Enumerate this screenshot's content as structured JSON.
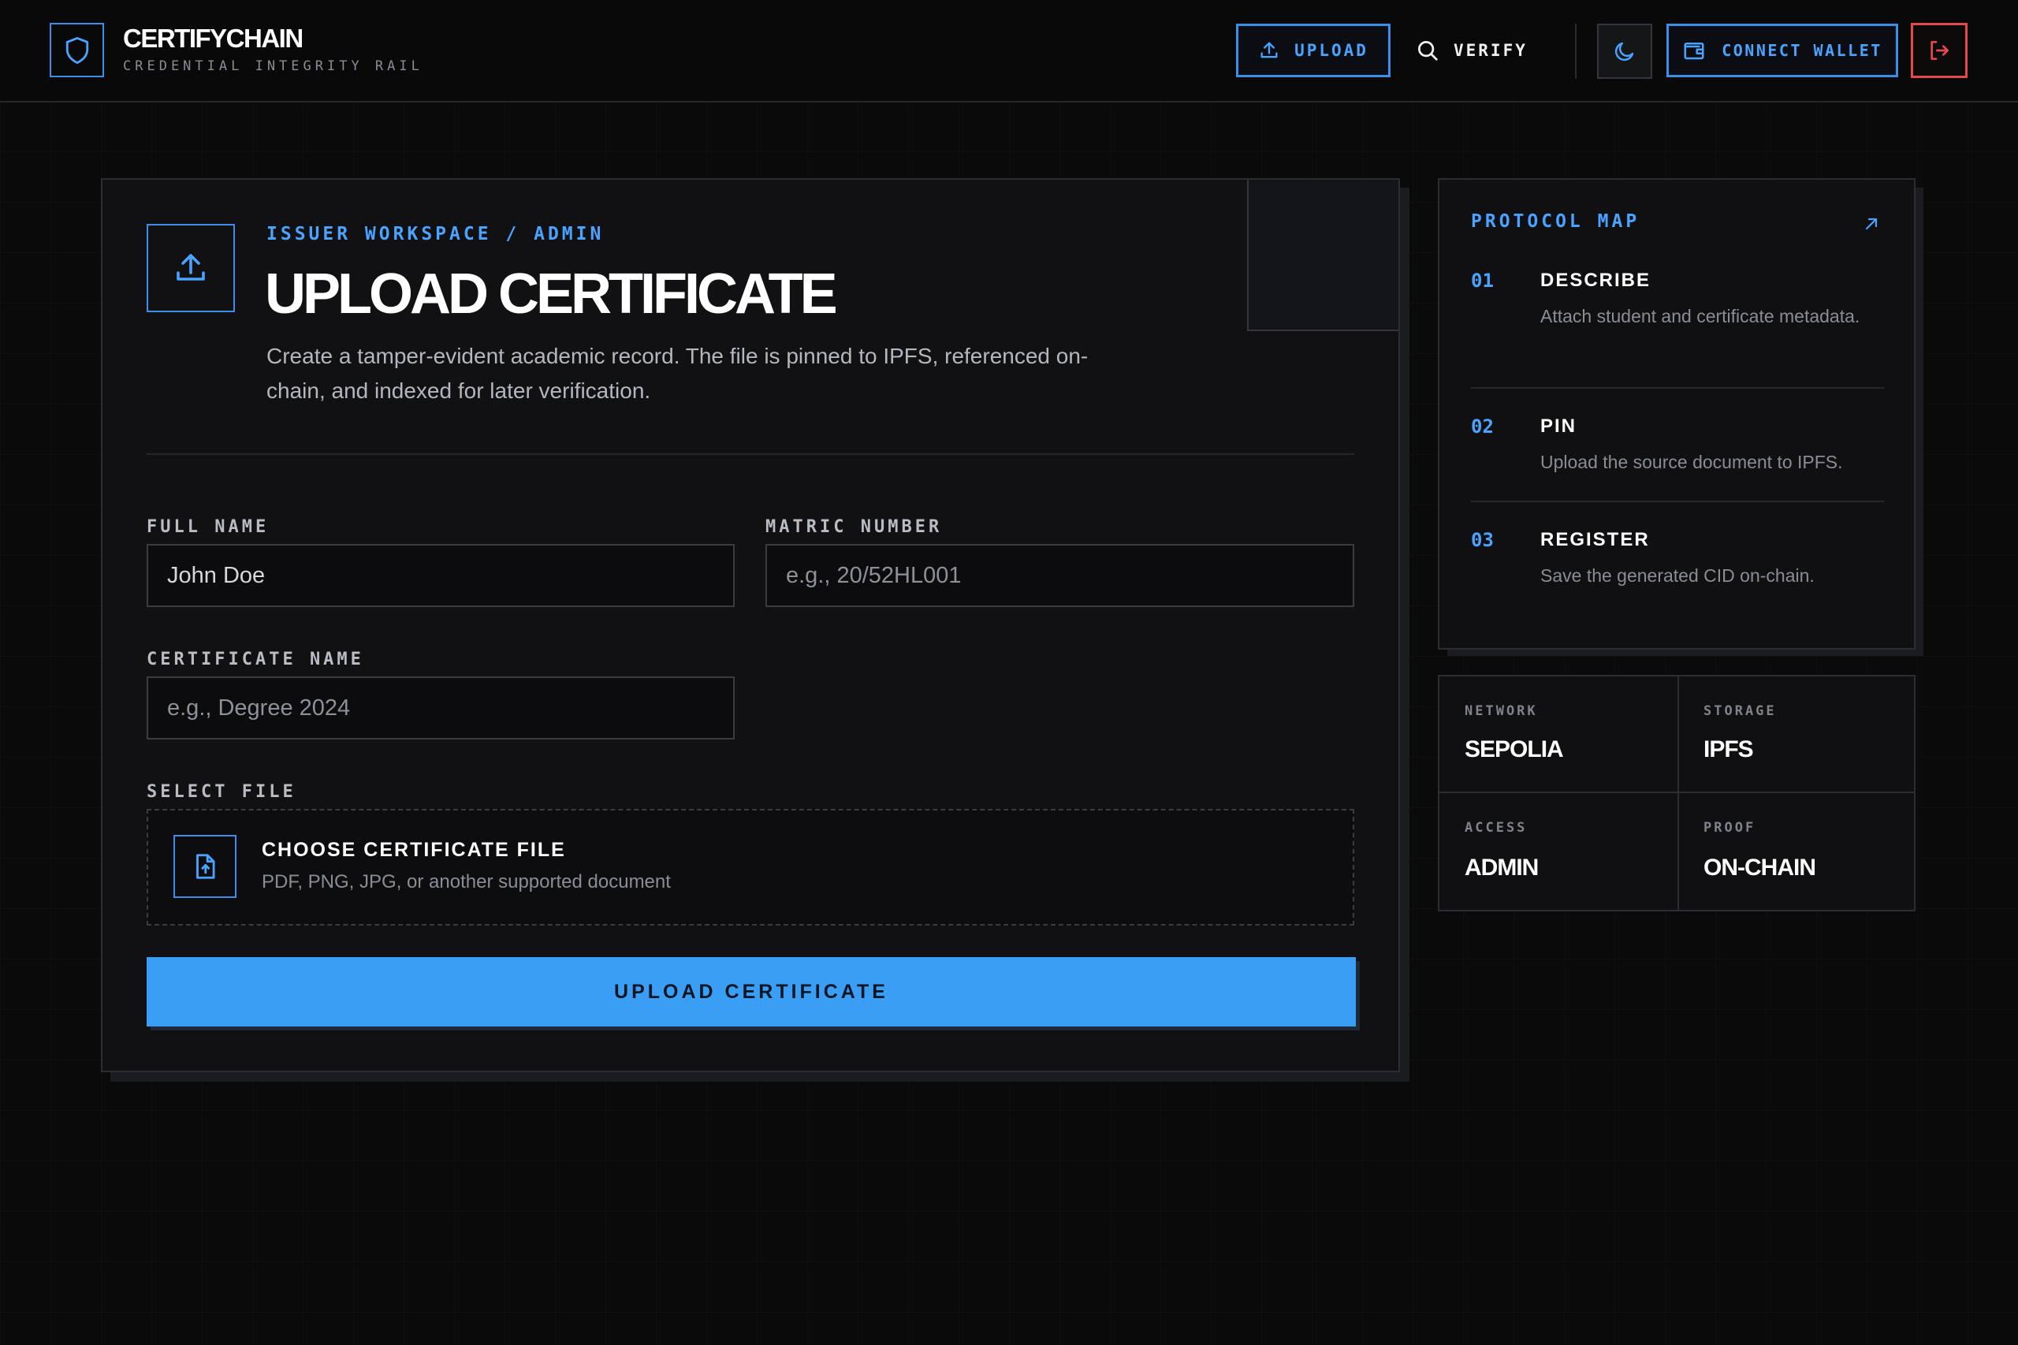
{
  "brand": {
    "title": "CERTIFYCHAIN",
    "subtitle": "CREDENTIAL INTEGRITY RAIL",
    "logo_icon": "shield-icon"
  },
  "nav": {
    "upload_label": "UPLOAD",
    "verify_label": "VERIFY",
    "connect_wallet_label": "CONNECT WALLET",
    "theme_icon": "moon-icon",
    "logout_icon": "logout-icon"
  },
  "form": {
    "breadcrumb": "ISSUER WORKSPACE / ADMIN",
    "title": "UPLOAD CERTIFICATE",
    "description": "Create a tamper-evident academic record. The file is pinned to IPFS, referenced on-chain, and indexed for later verification.",
    "full_name_label": "FULL NAME",
    "full_name_value": "John Doe",
    "matric_label": "MATRIC NUMBER",
    "matric_placeholder": "e.g., 20/52HL001",
    "cert_name_label": "CERTIFICATE NAME",
    "cert_name_placeholder": "e.g., Degree 2024",
    "select_file_label": "SELECT FILE",
    "file_title": "CHOOSE CERTIFICATE FILE",
    "file_hint": "PDF, PNG, JPG, or another supported document",
    "submit_label": "UPLOAD CERTIFICATE"
  },
  "protocol_map": {
    "title": "PROTOCOL MAP",
    "steps": [
      {
        "num": "01",
        "title": "DESCRIBE",
        "desc": "Attach student and certificate metadata."
      },
      {
        "num": "02",
        "title": "PIN",
        "desc": "Upload the source document to IPFS."
      },
      {
        "num": "03",
        "title": "REGISTER",
        "desc": "Save the generated CID on-chain."
      }
    ]
  },
  "stats": [
    {
      "label": "NETWORK",
      "value": "SEPOLIA"
    },
    {
      "label": "STORAGE",
      "value": "IPFS"
    },
    {
      "label": "ACCESS",
      "value": "ADMIN"
    },
    {
      "label": "PROOF",
      "value": "ON-CHAIN"
    }
  ],
  "colors": {
    "accent": "#3b9ef5",
    "danger": "#e5484d",
    "background": "#0a0a0b"
  }
}
